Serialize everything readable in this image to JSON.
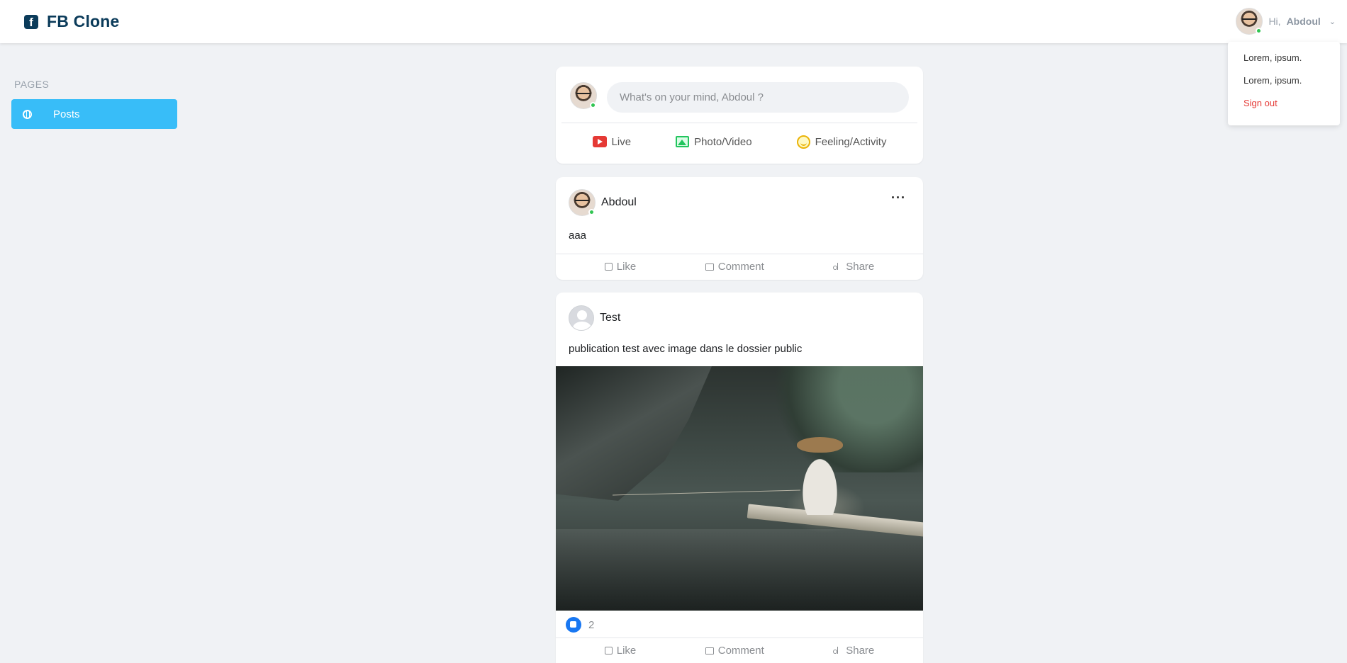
{
  "app": {
    "title": "FB Clone",
    "logo_icon": "facebook-square-icon"
  },
  "header": {
    "greeting": "Hi,",
    "username": "Abdoul",
    "chevron_icon": "chevron-down-icon"
  },
  "user_dropdown": {
    "items": [
      {
        "label": "Lorem, ipsum."
      },
      {
        "label": "Lorem, ipsum."
      },
      {
        "label": "Sign out",
        "color": "#e53935"
      }
    ]
  },
  "sidebar": {
    "title": "PAGES",
    "items": [
      {
        "label": "Posts",
        "icon": "globe-icon",
        "active": true,
        "color": "#38bdf8"
      }
    ]
  },
  "composer": {
    "placeholder": "What's on your mind, Abdoul ?",
    "actions": [
      {
        "label": "Live",
        "icon": "video-icon",
        "color": "#e53935"
      },
      {
        "label": "Photo/Video",
        "icon": "photo-icon",
        "color": "#22c55e"
      },
      {
        "label": "Feeling/Activity",
        "icon": "smile-icon",
        "color": "#eab308"
      }
    ]
  },
  "posts": [
    {
      "author": "Abdoul",
      "text": "aaa",
      "has_image": false,
      "actions": {
        "like": "Like",
        "comment": "Comment",
        "share": "Share"
      }
    },
    {
      "author": "Test",
      "text": "publication test avec image dans le dossier public",
      "has_image": true,
      "like_count": "2",
      "actions": {
        "like": "Like",
        "comment": "Comment",
        "share": "Share"
      }
    }
  ]
}
